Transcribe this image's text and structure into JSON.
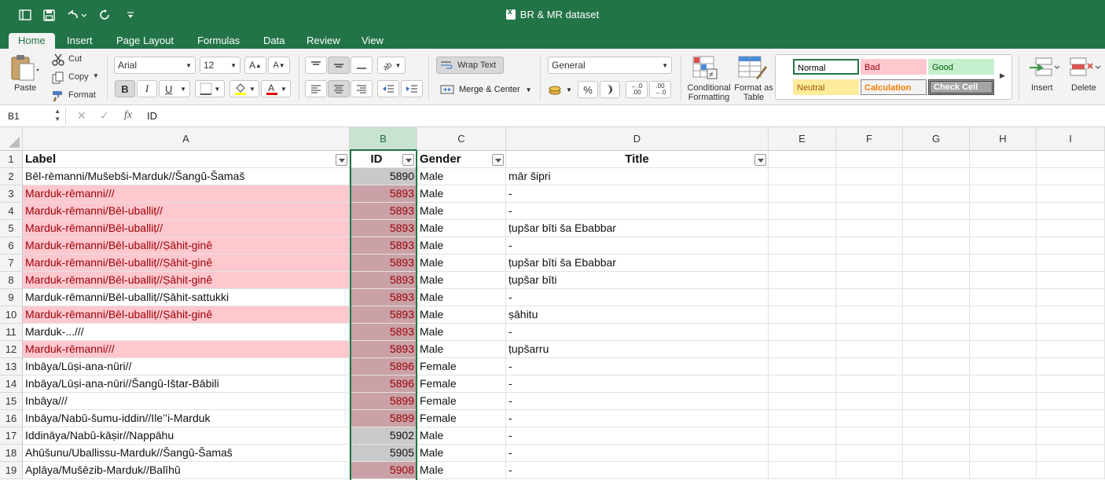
{
  "window": {
    "title": "BR & MR dataset"
  },
  "tabs": [
    "Home",
    "Insert",
    "Page Layout",
    "Formulas",
    "Data",
    "Review",
    "View"
  ],
  "ribbon": {
    "paste": "Paste",
    "cut": "Cut",
    "copy": "Copy",
    "format": "Format",
    "font_name": "Arial",
    "font_size": "12",
    "bold": "B",
    "italic": "I",
    "underline": "U",
    "wrap_text": "Wrap Text",
    "merge_center": "Merge & Center",
    "number_format": "General",
    "percent": "%",
    "comma": "❩",
    "inc_decimal": "←.0\n.00",
    "dec_decimal": ".00\n→.0",
    "conditional_formatting": "Conditional Formatting",
    "format_as_table": "Format as Table",
    "styles": {
      "normal": "Normal",
      "bad": "Bad",
      "good": "Good",
      "neutral": "Neutral",
      "calculation": "Calculation",
      "check_cell": "Check Cell"
    },
    "insert": "Insert",
    "delete": "Delete"
  },
  "formula_bar": {
    "name_box": "B1",
    "fx": "fx",
    "value": "ID"
  },
  "columns": [
    "A",
    "B",
    "C",
    "D",
    "E",
    "F",
    "G",
    "H",
    "I"
  ],
  "header_row": {
    "label": "Label",
    "id": "ID",
    "gender": "Gender",
    "title": "Title"
  },
  "rows": [
    {
      "n": "2",
      "label": "Bēl-rēmanni/Mušebši-Marduk//Šangû-Šamaš",
      "id": "5890",
      "gender": "Male",
      "title": "mār šipri",
      "dup": false,
      "idgray": true
    },
    {
      "n": "3",
      "label": "Marduk-rēmanni///",
      "id": "5893",
      "gender": "Male",
      "title": "-",
      "dup": true,
      "idgray": false
    },
    {
      "n": "4",
      "label": "Marduk-rēmanni/Bēl-uballiṭ//",
      "id": "5893",
      "gender": "Male",
      "title": "-",
      "dup": true,
      "idgray": false
    },
    {
      "n": "5",
      "label": "Marduk-rēmanni/Bēl-uballiṭ//",
      "id": "5893",
      "gender": "Male",
      "title": "ṭupšar bīti ša Ebabbar",
      "dup": true,
      "idgray": false
    },
    {
      "n": "6",
      "label": "Marduk-rēmanni/Bēl-uballiṭ//Ṣāhit-ginê",
      "id": "5893",
      "gender": "Male",
      "title": "-",
      "dup": true,
      "idgray": false
    },
    {
      "n": "7",
      "label": "Marduk-rēmanni/Bēl-uballiṭ//Ṣāhit-ginê",
      "id": "5893",
      "gender": "Male",
      "title": "ṭupšar bīti ša Ebabbar",
      "dup": true,
      "idgray": false
    },
    {
      "n": "8",
      "label": "Marduk-rēmanni/Bēl-uballiṭ//Ṣāhit-ginê",
      "id": "5893",
      "gender": "Male",
      "title": "ṭupšar bīti",
      "dup": true,
      "idgray": false
    },
    {
      "n": "9",
      "label": "Marduk-rēmanni/Bēl-uballiṭ//Ṣāhit-sattukki",
      "id": "5893",
      "gender": "Male",
      "title": "-",
      "dup": false,
      "idgray": false
    },
    {
      "n": "10",
      "label": "Marduk-rēmanni/Bēl-uballiṭ//Ṣāhit-ginê",
      "id": "5893",
      "gender": "Male",
      "title": "ṣāhitu",
      "dup": true,
      "idgray": false
    },
    {
      "n": "11",
      "label": "Marduk-...///",
      "id": "5893",
      "gender": "Male",
      "title": "-",
      "dup": false,
      "idgray": false
    },
    {
      "n": "12",
      "label": "Marduk-rēmanni///",
      "id": "5893",
      "gender": "Male",
      "title": "ṭupšarru",
      "dup": true,
      "idgray": false
    },
    {
      "n": "13",
      "label": "Inbāya/Lūṣi-ana-nūri//",
      "id": "5896",
      "gender": "Female",
      "title": "-",
      "dup": false,
      "idgray": false
    },
    {
      "n": "14",
      "label": "Inbāya/Lūṣi-ana-nūri//Šangû-Ištar-Bābili",
      "id": "5896",
      "gender": "Female",
      "title": "-",
      "dup": false,
      "idgray": false
    },
    {
      "n": "15",
      "label": "Inbāya///",
      "id": "5899",
      "gender": "Female",
      "title": "-",
      "dup": false,
      "idgray": false
    },
    {
      "n": "16",
      "label": "Inbāya/Nabû-šumu-iddin//Ile’’i-Marduk",
      "id": "5899",
      "gender": "Female",
      "title": "-",
      "dup": false,
      "idgray": false
    },
    {
      "n": "17",
      "label": "Iddināya/Nabû-kāṣir//Nappāhu",
      "id": "5902",
      "gender": "Male",
      "title": "-",
      "dup": false,
      "idgray": true
    },
    {
      "n": "18",
      "label": "Ahūšunu/Uballissu-Marduk//Šangû-Šamaš",
      "id": "5905",
      "gender": "Male",
      "title": "-",
      "dup": false,
      "idgray": true
    },
    {
      "n": "19",
      "label": "Aplāya/Mušēzib-Marduk//Balīhû",
      "id": "5908",
      "gender": "Male",
      "title": "-",
      "dup": false,
      "idgray": false
    }
  ],
  "colors": {
    "accent": "#227447",
    "dup_fill": "#ffc7ce",
    "dup_text": "#9c0006",
    "id_dup_fill": "#c9a1a6",
    "id_gray_fill": "#c9c9c9"
  }
}
